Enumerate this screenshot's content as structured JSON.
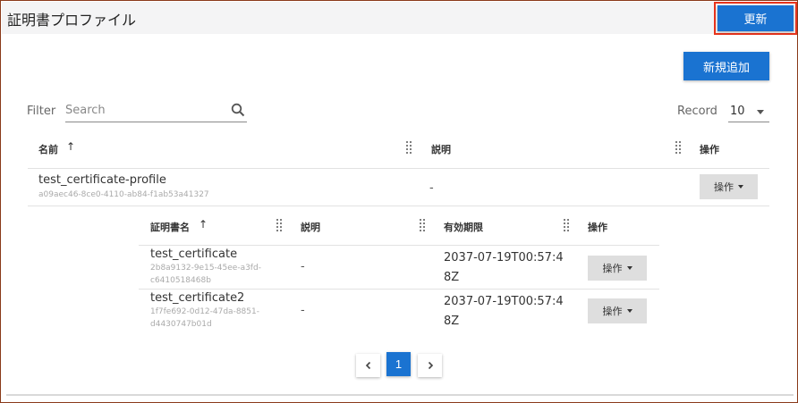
{
  "header": {
    "title": "証明書プロファイル",
    "refresh_label": "更新"
  },
  "toolbar": {
    "add_label": "新規追加",
    "filter_label": "Filter",
    "search_placeholder": "Search",
    "record_label": "Record",
    "record_value": "10"
  },
  "profile_table": {
    "columns": [
      "名前",
      "説明",
      "操作"
    ],
    "rows": [
      {
        "name": "test_certificate-profile",
        "id": "a09aec46-8ce0-4110-ab84-f1ab53a41327",
        "description": "-",
        "action_label": "操作"
      }
    ]
  },
  "certificate_table": {
    "columns": [
      "証明書名",
      "説明",
      "有効期限",
      "操作"
    ],
    "rows": [
      {
        "name": "test_certificate",
        "id_line1": "2b8a9132-9e15-45ee-a3fd-",
        "id_line2": "c6410518468b",
        "description": "-",
        "expiry": "2037-07-19T00:57:48Z",
        "action_label": "操作"
      },
      {
        "name": "test_certificate2",
        "id_line1": "1f7fe692-0d12-47da-8851-",
        "id_line2": "d4430747b01d",
        "description": "-",
        "expiry": "2037-07-19T00:57:48Z",
        "action_label": "操作"
      }
    ]
  },
  "pagination": {
    "prev_icon": "chevron-left-icon",
    "current_page": "1",
    "next_icon": "chevron-right-icon"
  },
  "colors": {
    "primary": "#1a73d1",
    "highlight_border": "#e8341c"
  }
}
